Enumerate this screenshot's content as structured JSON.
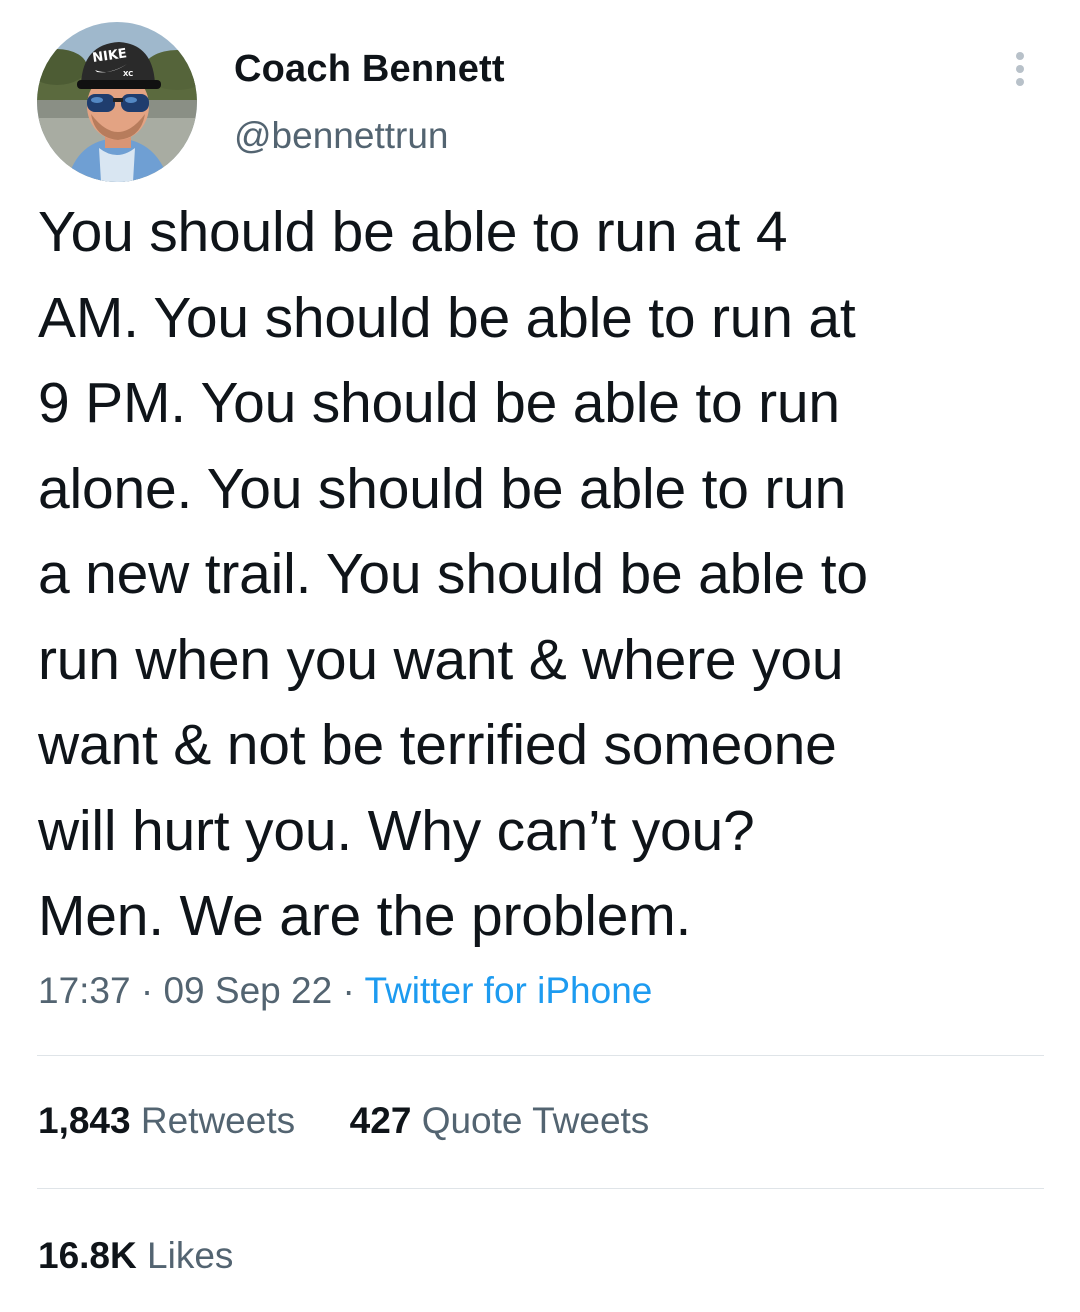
{
  "author": {
    "name": "Coach Bennett",
    "handle": "@bennettrun",
    "avatar_cap_text": "NIKE",
    "avatar_cap_subtext": "XC"
  },
  "tweet": {
    "text_lines": [
      "You should be able to run at 4",
      "AM. You should be able to run at",
      "9 PM. You should be able to run",
      "alone. You should be able to run",
      "a new trail. You should be able to",
      "run when you want & where you",
      "want & not be terrified someone",
      "will hurt you. Why can’t you?",
      "Men. We are the problem."
    ],
    "time": "17:37",
    "separator": "·",
    "date": "09 Sep 22",
    "source": "Twitter for iPhone"
  },
  "stats": {
    "retweets_count": "1,843",
    "retweets_label": "Retweets",
    "quotes_count": "427",
    "quotes_label": "Quote Tweets",
    "likes_count": "16.8K",
    "likes_label": "Likes"
  },
  "colors": {
    "text": "#0f1419",
    "secondary": "#536471",
    "link": "#1d9bf0",
    "divider": "#dfe4e8",
    "background": "#ffffff"
  },
  "icons": {
    "more": "more-options-icon"
  }
}
